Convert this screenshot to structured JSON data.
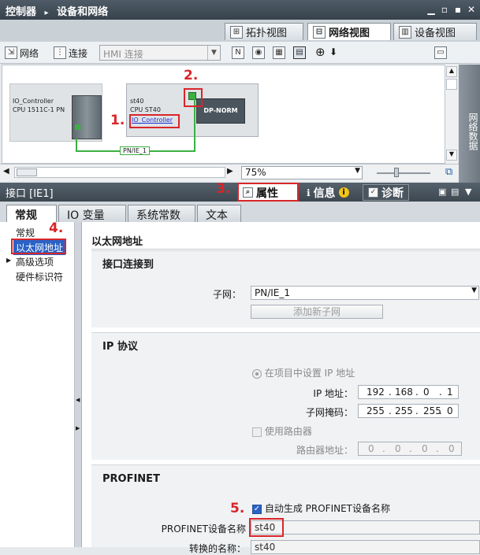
{
  "titlebar": {
    "crumb1": "控制器",
    "sep": "▸",
    "crumb2": "设备和网络",
    "controls": [
      "▁",
      "▫",
      "▪",
      "✕"
    ]
  },
  "view_tabs": {
    "topology": "拓扑视图",
    "network": "网络视图",
    "device": "设备视图"
  },
  "toolbar": {
    "network": "网络",
    "connect": "连接",
    "hmi_connect": "HMI 连接"
  },
  "devices": {
    "d1": {
      "name": "IO_Controller",
      "cpu": "CPU 1511C-1 PN"
    },
    "d2": {
      "name": "st40",
      "cpu": "CPU ST40",
      "link": "IO_Controller",
      "module": "DP-NORM"
    },
    "bus": "PN/IE_1"
  },
  "side_tab": "网络数据",
  "zoom": "75%",
  "inspector": {
    "title": "接口 [IE1]",
    "properties": "属性",
    "info": "信息",
    "diagnostics": "诊断"
  },
  "sub_tabs": {
    "general": "常规",
    "io_vars": "IO 变量",
    "sys_constants": "系统常数",
    "text": "文本"
  },
  "nav": {
    "general": "常规",
    "ethernet": "以太网地址",
    "advanced": "高级选项",
    "hw_id": "硬件标识符"
  },
  "ethernet": {
    "heading": "以太网地址",
    "interface_section": "接口连接到",
    "subnet_label": "子网：",
    "subnet_value": "PN/IE_1",
    "add_subnet": "添加新子网",
    "ip_section": "IP 协议",
    "set_in_project": "在项目中设置 IP 地址",
    "ip_label": "IP 地址：",
    "ip": [
      "192",
      "168",
      "0",
      "1"
    ],
    "mask_label": "子网掩码：",
    "mask": [
      "255",
      "255",
      "255",
      "0"
    ],
    "use_router": "使用路由器",
    "router_label": "路由器地址：",
    "router": [
      "0",
      "0",
      "0",
      "0"
    ],
    "profinet_section": "PROFINET",
    "auto_name": "自动生成 PROFINET设备名称",
    "device_name_label": "PROFINET设备名称",
    "device_name": "st40",
    "converted_label": "转换的名称：",
    "converted_value": "st40"
  },
  "annotations": {
    "n1": "1.",
    "n2": "2.",
    "n3": "3.",
    "n4": "4.",
    "n5": "5."
  },
  "colors": {
    "annotation": "#d8262a",
    "link_green": "#3cb043",
    "titlebar": "#3c4750"
  }
}
